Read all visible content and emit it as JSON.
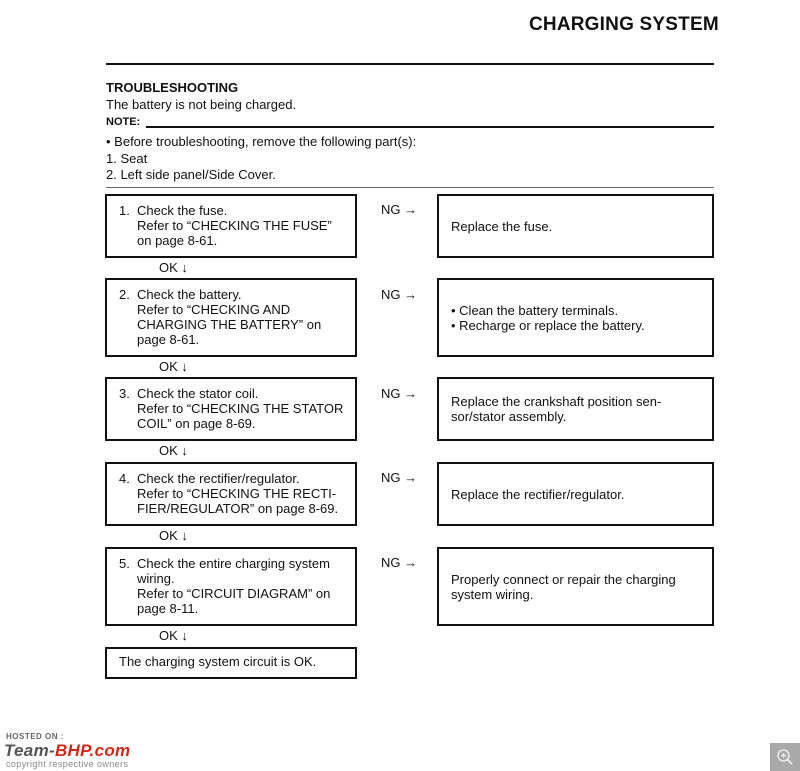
{
  "header": {
    "title": "CHARGING SYSTEM"
  },
  "section": {
    "heading": "TROUBLESHOOTING",
    "symptom": "The battery is not being charged."
  },
  "note": {
    "label": "NOTE:",
    "lines": [
      "• Before troubleshooting, remove the following part(s):",
      "1.  Seat",
      "2.  Left side panel/Side Cover."
    ]
  },
  "steps": [
    {
      "number": "1.",
      "lines": [
        "Check the fuse.",
        "Refer to “CHECKING THE FUSE”",
        "on page 8-61."
      ],
      "ng_label": "NG →",
      "ok_label": "OK ↓",
      "result_lines": [
        "Replace the fuse."
      ]
    },
    {
      "number": "2.",
      "lines": [
        "Check the battery.",
        "Refer to “CHECKING AND",
        "CHARGING THE BATTERY” on",
        "page 8-61."
      ],
      "ng_label": "NG →",
      "ok_label": "OK ↓",
      "result_lines": [
        "• Clean the battery terminals.",
        "• Recharge or replace the battery."
      ]
    },
    {
      "number": "3.",
      "lines": [
        "Check the stator coil.",
        "Refer to “CHECKING THE STATOR",
        "COIL” on page 8-69."
      ],
      "ng_label": "NG →",
      "ok_label": "OK ↓",
      "result_lines": [
        "Replace the crankshaft position sen-",
        "sor/stator assembly."
      ]
    },
    {
      "number": "4.",
      "lines": [
        "Check the rectifier/regulator.",
        "Refer to “CHECKING THE RECTI-",
        "FIER/REGULATOR” on page 8-69."
      ],
      "ng_label": "NG →",
      "ok_label": "OK ↓",
      "result_lines": [
        "Replace the rectifier/regulator."
      ]
    },
    {
      "number": "5.",
      "lines": [
        "Check the entire charging system",
        "wiring.",
        "Refer to “CIRCUIT DIAGRAM” on",
        "page 8-11."
      ],
      "ng_label": "NG →",
      "ok_label": "OK ↓",
      "result_lines": [
        "Properly connect or repair the charging",
        "system wiring."
      ]
    }
  ],
  "final": {
    "text": "The charging system circuit is OK."
  },
  "watermark": {
    "hosted": "HOSTED ON :",
    "logo_team": "Team-",
    "logo_bhp": "BHP.com",
    "copyright": "copyright respective owners"
  },
  "zoom_control": {
    "icon": "zoom-in-icon"
  }
}
